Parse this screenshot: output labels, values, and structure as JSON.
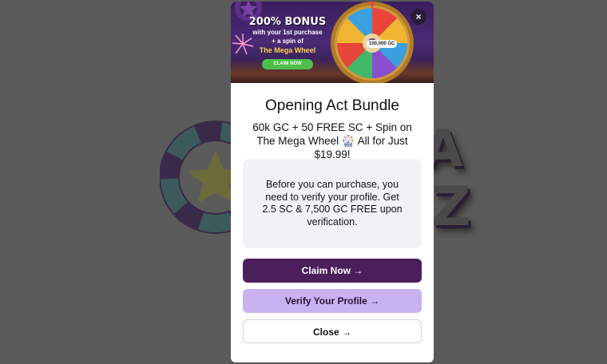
{
  "background": {
    "letters": [
      "A",
      "Z"
    ],
    "overlay_color": "#5a5a5a"
  },
  "banner": {
    "headline": "200% BONUS",
    "line1": "with your 1st purchase",
    "line2": "+ a spin of",
    "wheel_name": "The Mega Wheel",
    "claim_label": "CLAIM NOW",
    "wheel_value": "100,000 GC",
    "close_symbol": "×"
  },
  "modal": {
    "title": "Opening Act Bundle",
    "subtitle": "60k GC + 50 FREE SC + Spin on The Mega Wheel 🎡 All for Just $19.99!",
    "notice": "Before you can purchase, you need to verify your profile. Get 2.5 SC & 7,500 GC FREE upon verification.",
    "buttons": {
      "claim": "Claim Now →",
      "verify": "Verify Your Profile →",
      "close": "Close →"
    }
  },
  "colors": {
    "claim_button": "#4a1f5c",
    "verify_button": "#c9b2f0",
    "banner_claim": "#4cbf4a"
  }
}
